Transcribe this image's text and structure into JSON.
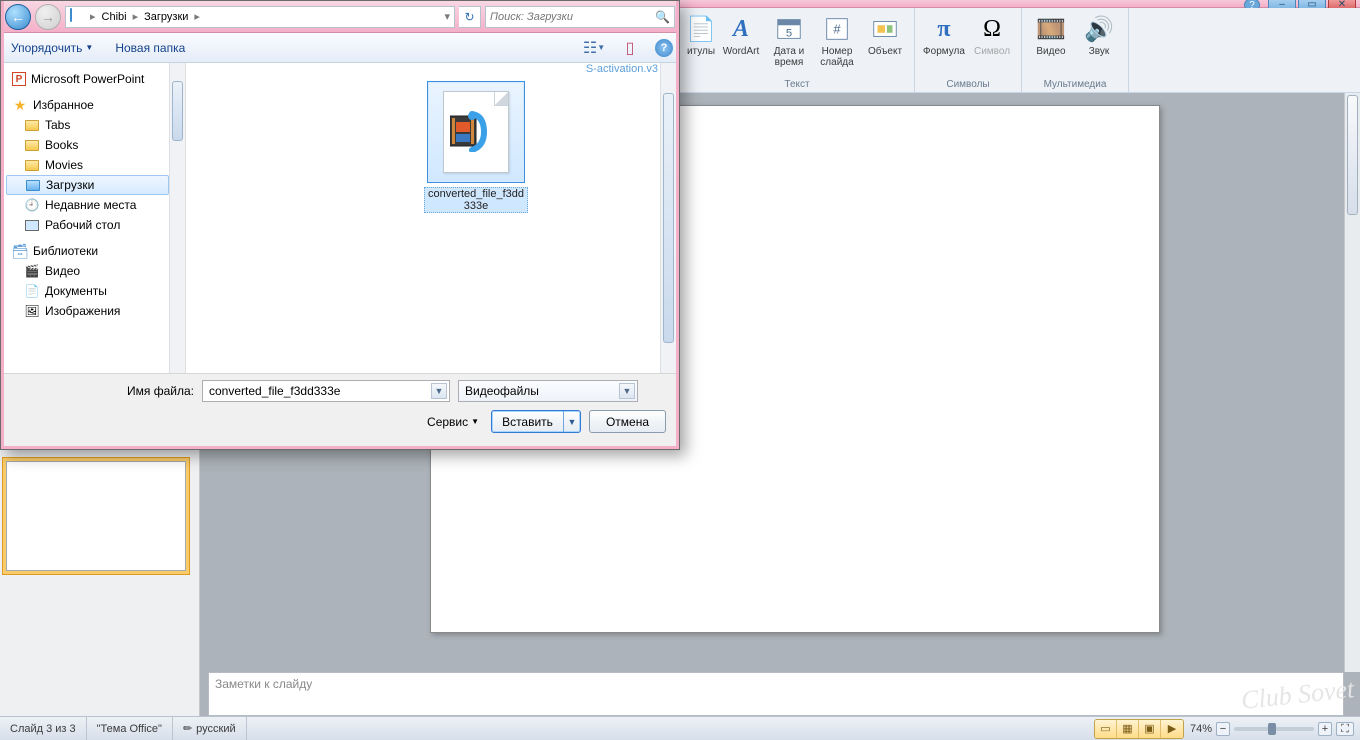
{
  "titlebar": {
    "help": "?"
  },
  "ribbon": {
    "items": {
      "tituly": "итулы",
      "wordart": "WordArt",
      "datetime": "Дата и\nвремя",
      "slidenum": "Номер\nслайда",
      "object": "Объект",
      "formula": "Формула",
      "symbol": "Символ",
      "video": "Видео",
      "sound": "Звук"
    },
    "groups": {
      "text": "Текст",
      "symbols": "Символы",
      "media": "Мультимедиа"
    }
  },
  "status": {
    "slide": "Слайд 3 из 3",
    "theme": "\"Тема Office\"",
    "lang": "русский",
    "zoom": "74%"
  },
  "notes_placeholder": "Заметки к слайду",
  "dialog": {
    "breadcrumb": {
      "user": "Chibi",
      "folder": "Загрузки"
    },
    "search_placeholder": "Поиск: Загрузки",
    "toolbar": {
      "organize": "Упорядочить",
      "newfolder": "Новая папка"
    },
    "nav": {
      "powerpoint": "Microsoft PowerPoint",
      "favorites": "Избранное",
      "fav_items": [
        "Tabs",
        "Books",
        "Movies",
        "Загрузки",
        "Недавние места",
        "Рабочий стол"
      ],
      "libraries": "Библиотеки",
      "lib_items": [
        "Видео",
        "Документы",
        "Изображения"
      ]
    },
    "files": {
      "partial": "S-activation.v3",
      "selected": "converted_file_f3dd333e"
    },
    "footer": {
      "filename_label": "Имя файла:",
      "filename_value": "converted_file_f3dd333e",
      "filter": "Видеофайлы",
      "service": "Сервис",
      "insert": "Вставить",
      "cancel": "Отмена"
    }
  },
  "watermark": "Club Sovet"
}
